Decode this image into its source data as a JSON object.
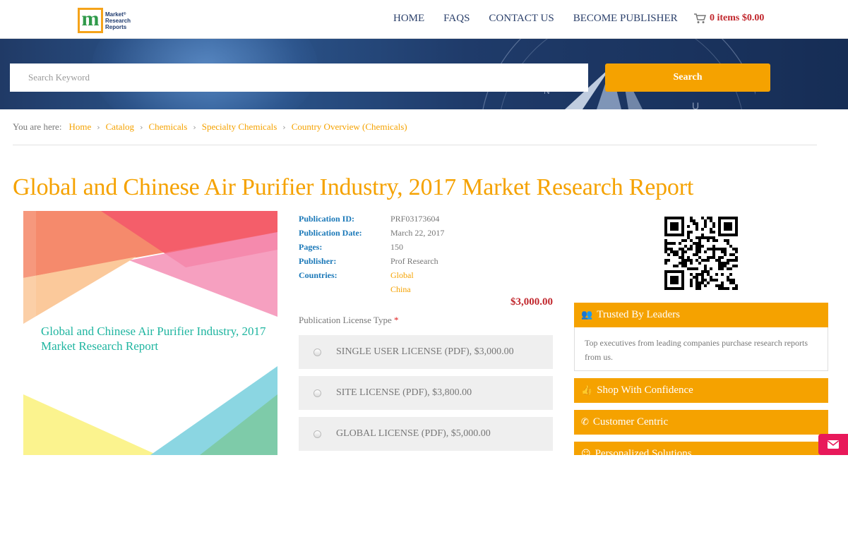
{
  "logo": {
    "line1": "Market",
    "line2": "Research",
    "line3": "Reports",
    "sup": "®",
    "mark": "m"
  },
  "nav": [
    "HOME",
    "FAQS",
    "CONTACT US",
    "BECOME PUBLISHER"
  ],
  "cart": {
    "label": "0 items $0.00",
    "icon": "cart-icon"
  },
  "search": {
    "placeholder": "Search Keyword",
    "button": "Search"
  },
  "breadcrumb": {
    "prefix": "You are here:",
    "items": [
      "Home",
      "Catalog",
      "Chemicals",
      "Specialty Chemicals",
      "Country Overview (Chemicals)"
    ]
  },
  "title": "Global and Chinese Air Purifier Industry, 2017 Market Research Report",
  "cover": {
    "title": "Global and Chinese Air Purifier Industry, 2017 Market Research Report"
  },
  "details": {
    "publication_id_label": "Publication ID:",
    "publication_id": "PRF03173604",
    "publication_date_label": "Publication Date:",
    "publication_date": "March 22, 2017",
    "pages_label": "Pages:",
    "pages": "150",
    "publisher_label": "Publisher:",
    "publisher": "Prof Research",
    "countries_label": "Countries:",
    "countries": [
      "Global",
      "China"
    ]
  },
  "price": "$3,000.00",
  "license": {
    "label": "Publication License Type",
    "required_mark": "*",
    "options": [
      "SINGLE USER LICENSE (PDF), $3,000.00",
      "SITE LICENSE (PDF), $3,800.00",
      "GLOBAL LICENSE (PDF), $5,000.00"
    ]
  },
  "side": {
    "trusted": {
      "title": "Trusted By Leaders",
      "icon": "users-icon",
      "body": "Top executives from leading companies purchase research reports from us."
    },
    "shop": {
      "title": "Shop With Confidence",
      "icon": "thumbs-up-icon"
    },
    "customer": {
      "title": "Customer Centric",
      "icon": "phone-icon"
    },
    "personalized": {
      "title": "Personalized Solutions",
      "icon": "smile-icon"
    }
  },
  "colors": {
    "accent": "#f5a200",
    "link_blue": "#1a78b8",
    "price_red": "#c1272d",
    "mail_tab": "#e8195a"
  }
}
